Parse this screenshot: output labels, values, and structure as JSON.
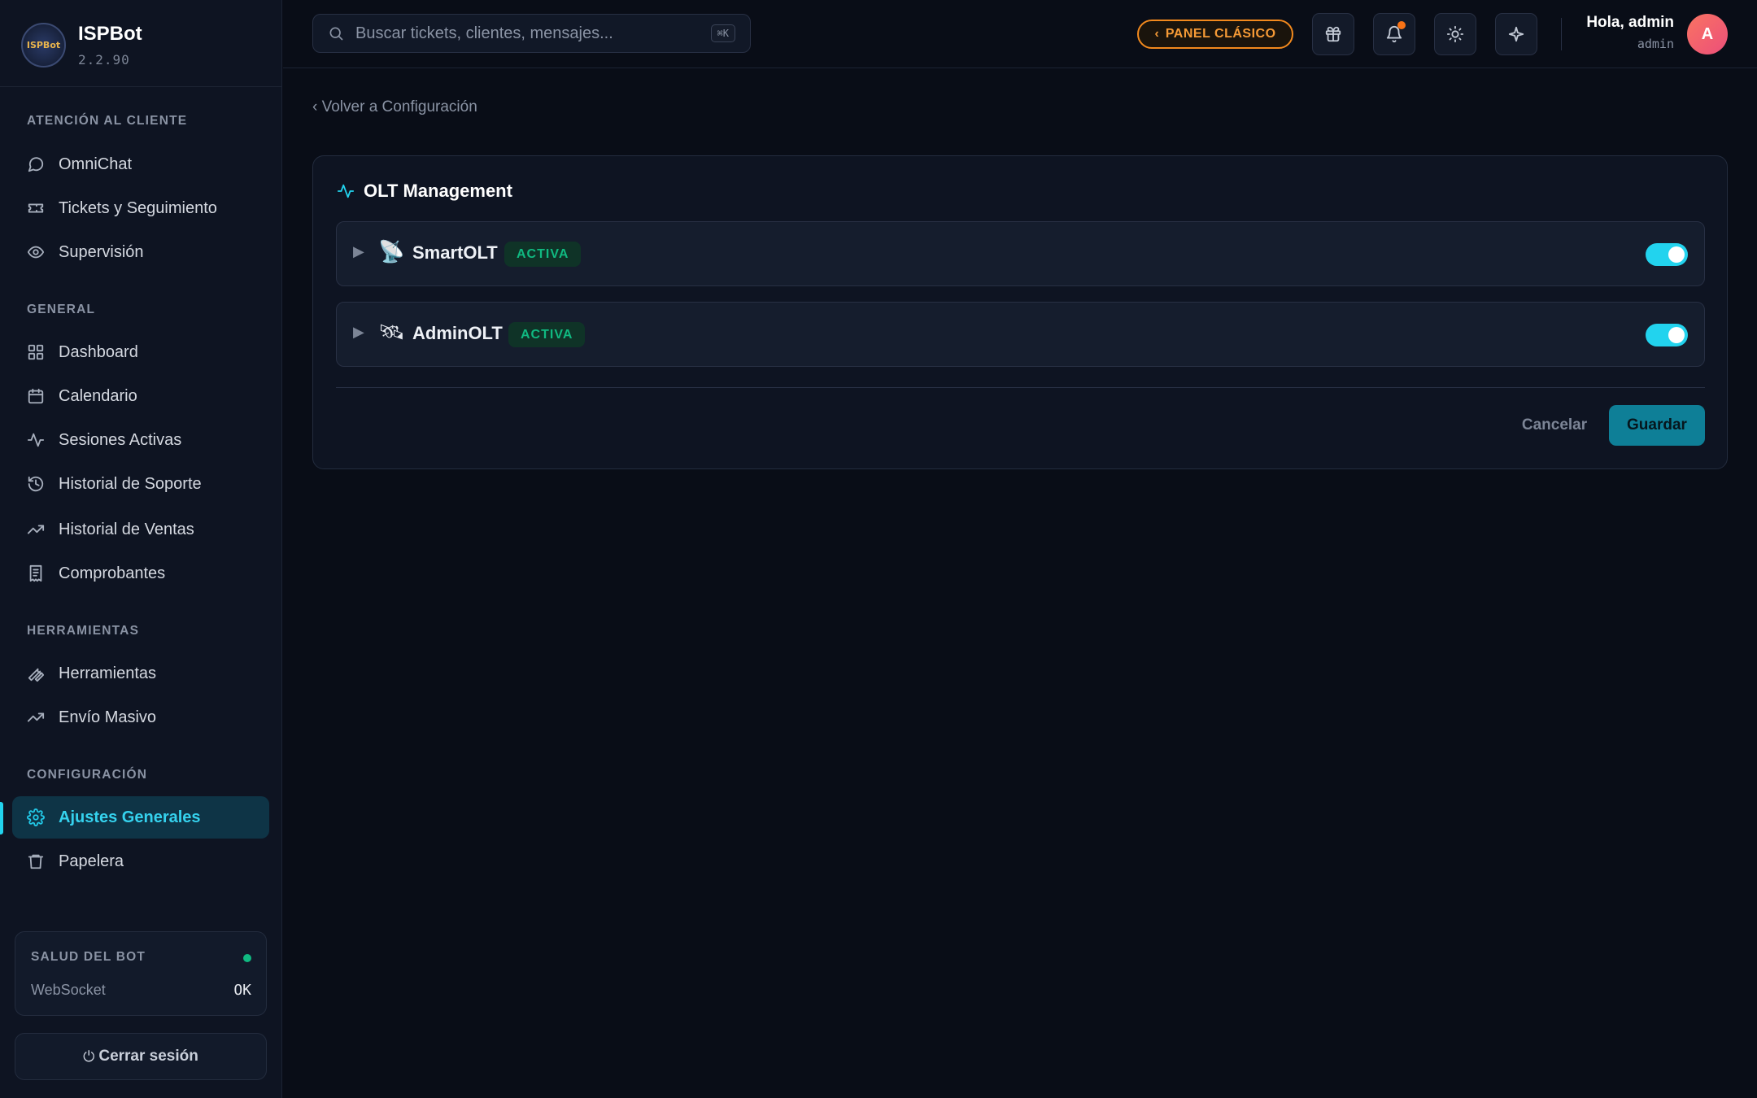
{
  "brand": {
    "name": "ISPBot",
    "version": "2.2.90",
    "logo_text": "ISPBot"
  },
  "sidebar": {
    "sections": [
      {
        "title": "ATENCIÓN AL CLIENTE",
        "items": [
          {
            "label": "OmniChat",
            "icon": "chat-bubble-icon"
          },
          {
            "label": "Tickets y Seguimiento",
            "icon": "ticket-icon"
          },
          {
            "label": "Supervisión",
            "icon": "eye-icon"
          }
        ]
      },
      {
        "title": "GENERAL",
        "items": [
          {
            "label": "Dashboard",
            "icon": "grid-icon"
          },
          {
            "label": "Calendario",
            "icon": "calendar-icon"
          },
          {
            "label": "Sesiones Activas",
            "icon": "activity-icon"
          },
          {
            "label": "Historial de Soporte",
            "icon": "history-icon"
          },
          {
            "label": "Historial de Ventas",
            "icon": "trending-up-icon"
          },
          {
            "label": "Comprobantes",
            "icon": "receipt-icon"
          }
        ]
      },
      {
        "title": "HERRAMIENTAS",
        "items": [
          {
            "label": "Herramientas",
            "icon": "wrench-icon"
          },
          {
            "label": "Envío Masivo",
            "icon": "trending-up-icon"
          }
        ]
      },
      {
        "title": "CONFIGURACIÓN",
        "items": [
          {
            "label": "Ajustes Generales",
            "icon": "gear-icon",
            "active": true
          },
          {
            "label": "Papelera",
            "icon": "trash-icon"
          }
        ]
      }
    ],
    "health": {
      "title": "SALUD DEL BOT",
      "label": "WebSocket",
      "value": "OK",
      "status_color": "#10b981"
    },
    "logout": {
      "icon": "⏻",
      "label": "Cerrar sesión"
    }
  },
  "topbar": {
    "search_placeholder": "Buscar tickets, clientes, mensajes...",
    "shortcut": "⌘K",
    "panel_button": {
      "chevron": "‹",
      "label": "PANEL CLÁSICO"
    },
    "icons": [
      "gift-icon",
      "bell-icon",
      "sun-icon",
      "sparkle-icon"
    ],
    "greeting": "Hola, admin",
    "role": "admin",
    "avatar_initial": "A"
  },
  "main": {
    "back_link": "‹ Volver a Configuración",
    "card": {
      "title": "OLT Management",
      "rows": [
        {
          "caret": "▶",
          "emoji": "📡",
          "name": "SmartOLT",
          "badge": "ACTIVA",
          "enabled": true
        },
        {
          "caret": "▶",
          "emoji": "🛰",
          "name": "AdminOLT",
          "badge": "ACTIVA",
          "enabled": true
        }
      ],
      "cancel_label": "Cancelar",
      "save_label": "Guardar"
    }
  },
  "colors": {
    "accent": "#22d3ee",
    "orange": "#f59a36",
    "success": "#10b981",
    "background": "#090d17"
  }
}
